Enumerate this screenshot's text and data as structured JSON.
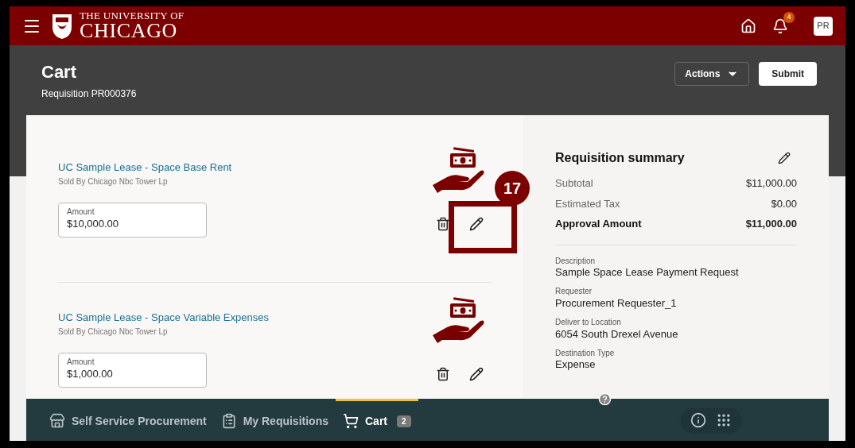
{
  "header": {
    "logo_line1": "THE UNIVERSITY OF",
    "logo_line2": "CHICAGO",
    "notification_count": "4",
    "avatar": "PR"
  },
  "page": {
    "title": "Cart",
    "subtitle": "Requisition PR000376",
    "actions_button": "Actions",
    "submit_button": "Submit"
  },
  "cart_items": [
    {
      "name": "UC Sample Lease - Space Base Rent",
      "seller": "Sold By Chicago Nbc Tower Lp",
      "amount_label": "Amount",
      "amount": "$10,000.00",
      "callout": "17"
    },
    {
      "name": "UC Sample Lease - Space Variable Expenses",
      "seller": "Sold By Chicago Nbc Tower Lp",
      "amount_label": "Amount",
      "amount": "$1,000.00"
    }
  ],
  "summary": {
    "title": "Requisition summary",
    "totals": [
      {
        "label": "Subtotal",
        "value": "$11,000.00",
        "bold": false
      },
      {
        "label": "Estimated Tax",
        "value": "$0.00",
        "bold": false
      },
      {
        "label": "Approval Amount",
        "value": "$11,000.00",
        "bold": true
      }
    ],
    "details": [
      {
        "label": "Description",
        "value": "Sample Space Lease Payment Request"
      },
      {
        "label": "Requester",
        "value": "Procurement Requester_1"
      },
      {
        "label": "Deliver to Location",
        "value": "6054 South Drexel Avenue"
      },
      {
        "label": "Destination Type",
        "value": "Expense"
      }
    ]
  },
  "bottom_nav": [
    {
      "label": "Self Service Procurement",
      "kind": "store",
      "selected": false
    },
    {
      "label": "My Requisitions",
      "kind": "list",
      "selected": false
    },
    {
      "label": "Cart",
      "kind": "cart",
      "selected": true,
      "count": "2"
    }
  ]
}
